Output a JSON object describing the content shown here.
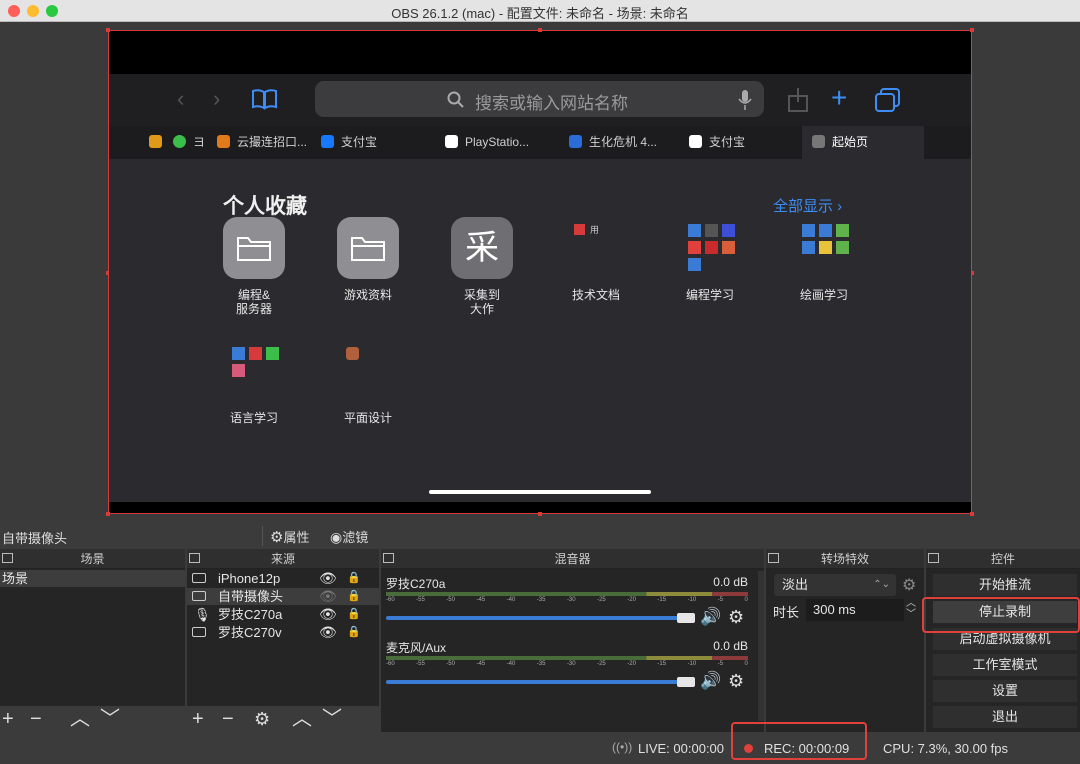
{
  "window": {
    "title": "OBS 26.1.2 (mac) - 配置文件: 未命名 - 场景: 未命名"
  },
  "browser": {
    "search_placeholder": "搜索或输入网站名称",
    "tabs": [
      "云撮连招口...",
      "支付宝",
      "PlayStatio...",
      "生化危机 4...",
      "支付宝",
      "起始页"
    ],
    "favorites_title": "个人收藏",
    "show_all": "全部显示 ›",
    "favorites": [
      {
        "label": "编程&\n服务器",
        "glyph": ""
      },
      {
        "label": "游戏资料",
        "glyph": ""
      },
      {
        "label": "采集到\n大作",
        "glyph": "采"
      },
      {
        "label": "技术文档",
        "glyph": ""
      },
      {
        "label": "编程学习",
        "glyph": ""
      },
      {
        "label": "绘画学习",
        "glyph": ""
      },
      {
        "label": "语言学习",
        "glyph": ""
      },
      {
        "label": "平面设计",
        "glyph": ""
      }
    ]
  },
  "obs": {
    "source_title": "自带摄像头",
    "properties": "属性",
    "filters": "滤镜",
    "panels": {
      "scenes": "场景",
      "sources": "来源",
      "mixer": "混音器",
      "transitions": "转场特效",
      "controls": "控件"
    },
    "scenes": [
      "场景"
    ],
    "sources": [
      "iPhone12p",
      "自带摄像头",
      "罗技C270a",
      "罗技C270v"
    ],
    "mixer": [
      {
        "name": "罗技C270a",
        "db": "0.0 dB"
      },
      {
        "name": "麦克风/Aux",
        "db": "0.0 dB"
      }
    ],
    "meter_ticks": [
      "-60",
      "-55",
      "-50",
      "-45",
      "-40",
      "-35",
      "-30",
      "-25",
      "-20",
      "-15",
      "-10",
      "-5",
      "0"
    ],
    "transition": {
      "selected": "淡出",
      "duration_label": "时长",
      "duration": "300 ms"
    },
    "controls": [
      "开始推流",
      "停止录制",
      "启动虚拟摄像机",
      "工作室模式",
      "设置",
      "退出"
    ],
    "status": {
      "live": "LIVE: 00:00:00",
      "rec": "REC: 00:00:09",
      "cpu": "CPU: 7.3%, 30.00 fps"
    }
  },
  "colors": {
    "accent_red": "#e0413c",
    "fader_blue": "#3a7bd5",
    "link_blue": "#3d8df5"
  }
}
